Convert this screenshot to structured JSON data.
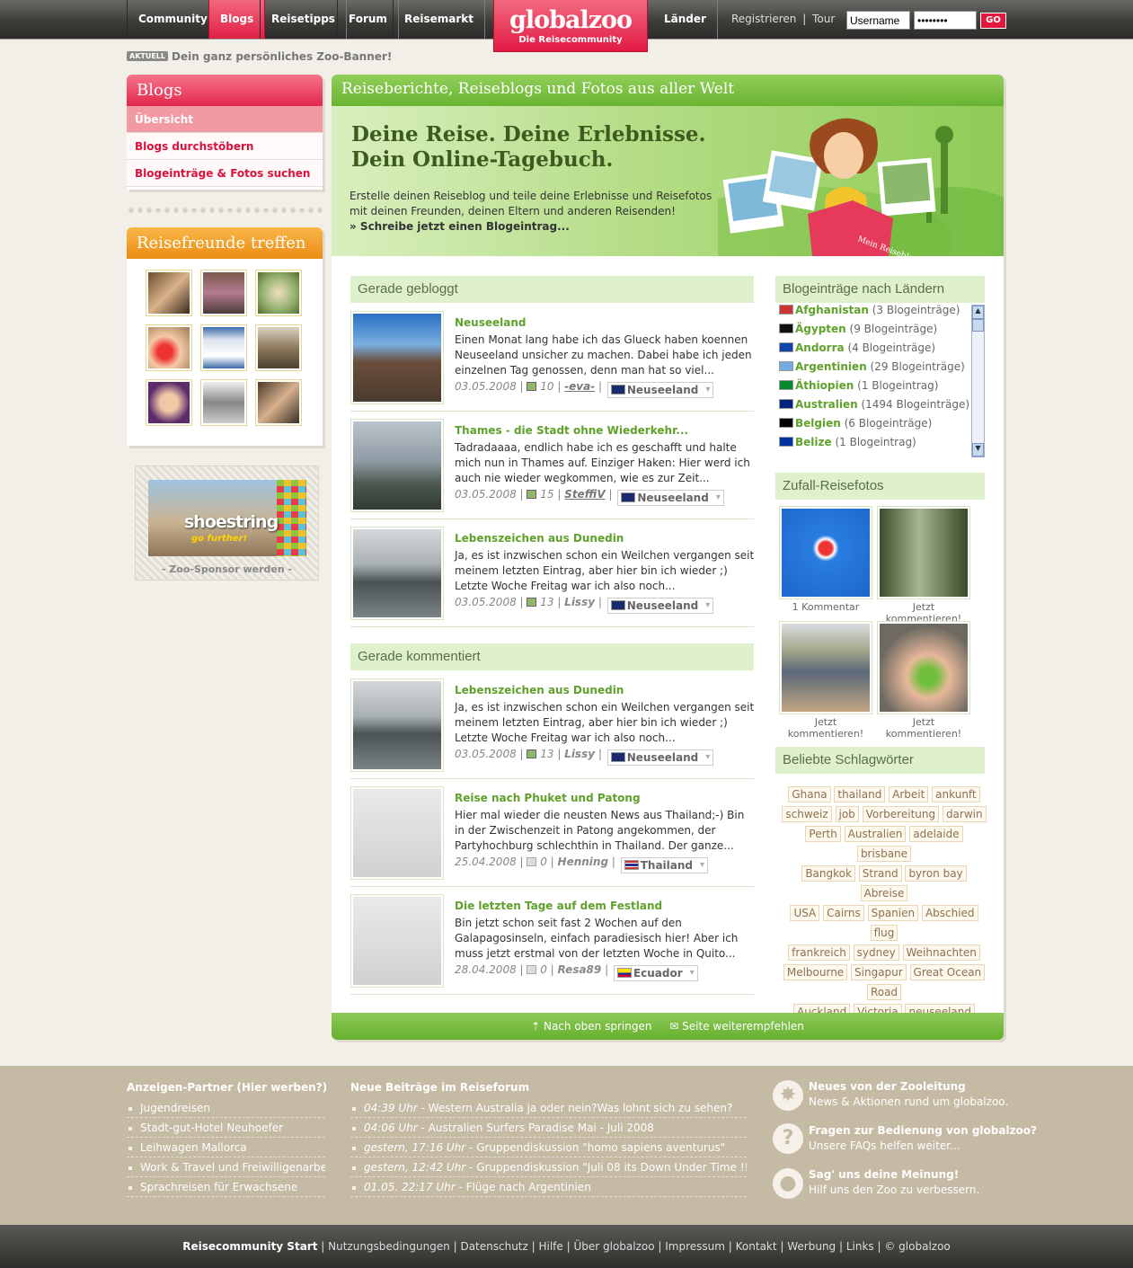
{
  "nav": {
    "items": [
      "Community",
      "Blogs",
      "Reisetipps",
      "Forum",
      "Reisemarkt"
    ],
    "active": "Blogs",
    "laender": "Länder"
  },
  "logo": {
    "name": "globalzoo",
    "tagline": "Die Reisecommunity"
  },
  "toplinks": {
    "register": "Registrieren",
    "sep": "|",
    "tour": "Tour"
  },
  "login": {
    "username": "Username",
    "password": "••••••••",
    "go": "GO"
  },
  "aktuell": {
    "badge": "AKTUELL",
    "text": "Dein ganz persönliches Zoo-Banner!"
  },
  "sidebar": {
    "blogs_title": "Blogs",
    "blogs_menu": [
      "Übersicht",
      "Blogs durchstöbern",
      "Blogeinträge & Fotos suchen"
    ],
    "freunde_title": "Reisefreunde treffen",
    "sponsor_text": "shoestring",
    "sponsor_sub": "go further!",
    "sponsor_caption": "- Zoo-Sponsor werden -"
  },
  "main": {
    "header": "Reiseberichte, Reiseblogs und Fotos aus aller Welt",
    "banner_h1": "Deine Reise. Deine Erlebnisse.",
    "banner_h2": "Dein Online-Tagebuch.",
    "banner_text": "Erstelle deinen Reiseblog und teile deine Erlebnisse und Reisefotos mit deinen Freunden, deinen Eltern und anderen Reisenden!",
    "banner_cta": "» Schreibe jetzt einen Blogeintrag...",
    "book_label": "Mein Reiseblog",
    "section_blogged": "Gerade gebloggt",
    "section_commented": "Gerade kommentiert",
    "blogged": [
      {
        "title": "Neuseeland",
        "text": "Einen Monat lang habe ich das Glueck haben koennen Neuseeland unsicher zu machen. Dabei habe ich jeden einzelnen Tag genossen, denn man hat so viel...",
        "date": "03.05.2008",
        "count": "10",
        "user": "-eva-",
        "country": "Neuseeland"
      },
      {
        "title": "Thames - die Stadt ohne Wiederkehr...",
        "text": "Tadradaaaa, endlich habe ich es geschafft und halte mich nun in Thames auf. Einziger Haken: Hier werd ich auch nie wieder wegkommen, wie es zur Zeit...",
        "date": "03.05.2008",
        "count": "15",
        "user": "SteffiV",
        "country": "Neuseeland"
      },
      {
        "title": "Lebenszeichen aus Dunedin",
        "text": "Ja, es ist inzwischen schon ein Weilchen vergangen seit meinem letzten Eintrag, aber hier bin ich wieder ;) Letzte Woche Freitag war ich also noch...",
        "date": "03.05.2008",
        "count": "13",
        "user": "Lissy",
        "country": "Neuseeland"
      }
    ],
    "commented": [
      {
        "title": "Lebenszeichen aus Dunedin",
        "text": "Ja, es ist inzwischen schon ein Weilchen vergangen seit meinem letzten Eintrag, aber hier bin ich wieder ;) Letzte Woche Freitag war ich also noch...",
        "date": "03.05.2008",
        "count": "13",
        "user": "Lissy",
        "country": "Neuseeland"
      },
      {
        "title": "Reise nach Phuket und Patong",
        "text": "Hier mal wieder die neusten News aus Thailand;-) Bin in der Zwischenzeit in Patong angekommen, der Partyhochburg schlechthin in Thailand. Der ganze...",
        "date": "25.04.2008",
        "count": "0",
        "user": "Henning",
        "country": "Thailand"
      },
      {
        "title": "Die letzten Tage auf dem Festland",
        "text": "Bin jetzt schon seit fast 2 Wochen auf den Galapagosinseln, einfach paradiesisch hier! Aber ich muss jetzt erstmal von der letzten Woche in Quito...",
        "date": "28.04.2008",
        "count": "0",
        "user": "Resa89",
        "country": "Ecuador"
      }
    ],
    "section_laender": "Blogeinträge nach Ländern",
    "laender": [
      {
        "name": "Afghanistan",
        "count": "(3 Blogeinträge)"
      },
      {
        "name": "Ägypten",
        "count": "(9 Blogeinträge)"
      },
      {
        "name": "Andorra",
        "count": "(4 Blogeinträge)"
      },
      {
        "name": "Argentinien",
        "count": "(29 Blogeinträge)"
      },
      {
        "name": "Äthiopien",
        "count": "(1 Blogeintrag)"
      },
      {
        "name": "Australien",
        "count": "(1494 Blogeinträge)"
      },
      {
        "name": "Belgien",
        "count": "(6 Blogeinträge)"
      },
      {
        "name": "Belize",
        "count": "(1 Blogeintrag)"
      }
    ],
    "section_fotos": "Zufall-Reisefotos",
    "fotos_captions": [
      "1 Kommentar",
      "Jetzt kommentieren!",
      "Jetzt kommentieren!",
      "Jetzt kommentieren!"
    ],
    "section_tags": "Beliebte Schlagwörter",
    "tags": [
      "Ghana",
      "thailand",
      "Arbeit",
      "ankunft",
      "schweiz",
      "job",
      "Vorbereitung",
      "darwin",
      "Perth",
      "Australien",
      "adelaide",
      "brisbane",
      "Bangkok",
      "Strand",
      "byron bay",
      "Abreise",
      "USA",
      "Cairns",
      "Spanien",
      "Abschied",
      "flug",
      "frankreich",
      "sydney",
      "Weihnachten",
      "Melbourne",
      "Singapur",
      "Great Ocean",
      "Road",
      "Auckland",
      "Victoria",
      "neuseeland"
    ],
    "footer_top": "Nach oben springen",
    "footer_recommend": "Seite weiterempfehlen"
  },
  "footer": {
    "partner_title": "Anzeigen-Partner",
    "partner_sub": "(Hier werben?)",
    "partners": [
      "Jugendreisen",
      "Stadt-gut-Hotel Neuhoefer",
      "Leihwagen Mallorca",
      "Work & Travel und Freiwilligenarbeit",
      "Sprachreisen für Erwachsene"
    ],
    "forum_title": "Neue Beiträge im Reiseforum",
    "forum": [
      {
        "time": "04:39 Uhr",
        "text": " - Western Australia ja oder nein?Was lohnt sich zu sehen?"
      },
      {
        "time": "04:06 Uhr",
        "text": " - Australien Surfers Paradise Mai - Juli 2008"
      },
      {
        "time": "gestern, 17:16 Uhr",
        "text": " - Gruppendiskussion \"homo sapiens aventurus\""
      },
      {
        "time": "gestern, 12:42 Uhr",
        "text": " - Gruppendiskussion \"Juli 08 its Down Under Time !!!\""
      },
      {
        "time": "01.05. 22:17 Uhr",
        "text": " - Flüge nach Argentinien"
      }
    ],
    "info": [
      {
        "title": "Neues von der Zooleitung",
        "sub": "News & Aktionen rund um globalzoo."
      },
      {
        "title": "Fragen zur Bedienung von globalzoo?",
        "sub": "Unsere FAQs helfen weiter..."
      },
      {
        "title": "Sag' uns deine Meinung!",
        "sub": "Hilf uns den Zoo zu verbessern."
      }
    ]
  },
  "bottom": {
    "links": [
      "Nutzungsbedingungen",
      "Datenschutz",
      "Hilfe",
      "Über globalzoo",
      "Impressum",
      "Kontakt",
      "Werbung",
      "Links"
    ],
    "start": "Reisecommunity Start",
    "copyright": "© globalzoo"
  },
  "colors": {
    "pink": "#e2183f",
    "green": "#6ab432",
    "orange": "#ec8c14",
    "footer": "#c5baa4"
  }
}
